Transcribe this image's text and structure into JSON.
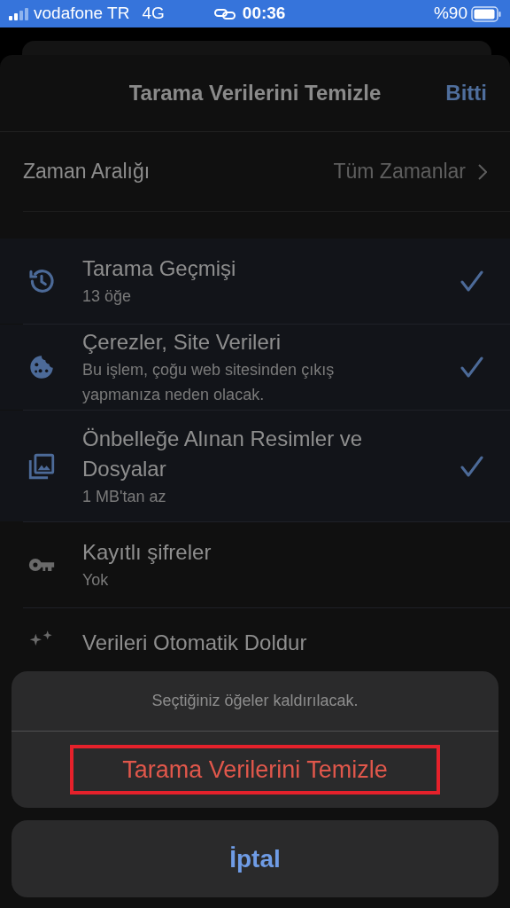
{
  "status_bar": {
    "carrier": "vodafone TR",
    "network": "4G",
    "time": "00:36",
    "battery": "%90"
  },
  "header": {
    "title": "Tarama Verilerini Temizle",
    "done": "Bitti"
  },
  "time_range": {
    "label": "Zaman Aralığı",
    "value": "Tüm Zamanlar"
  },
  "items": [
    {
      "title": "Tarama Geçmişi",
      "subtitle": "13 öğe",
      "checked": true
    },
    {
      "title": "Çerezler, Site Verileri",
      "subtitle": "Bu işlem, çoğu web sitesinden çıkış yapmanıza neden olacak.",
      "checked": true
    },
    {
      "title": "Önbelleğe Alınan Resimler ve Dosyalar",
      "subtitle": "1 MB'tan az",
      "checked": true
    },
    {
      "title": "Kayıtlı şifreler",
      "subtitle": "Yok",
      "checked": false
    },
    {
      "title": "Verileri Otomatik Doldur",
      "checked": false
    }
  ],
  "action_sheet": {
    "message": "Seçtiğiniz öğeler kaldırılacak.",
    "destructive": "Tarama Verilerini Temizle",
    "cancel": "İptal"
  }
}
